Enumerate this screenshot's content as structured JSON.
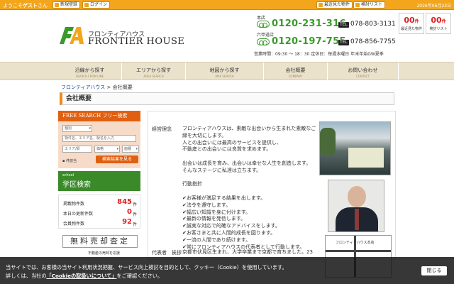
{
  "topbar": {
    "welcome_prefix": "ようこそ",
    "guest": "ゲスト",
    "welcome_suffix": "さん",
    "register": "新規登録",
    "login": "ログイン",
    "recent": "最近見た物件",
    "saved": "検討リスト",
    "date": "2026年06月23日"
  },
  "logo": {
    "jp": "フロンティアハウス",
    "en": "FRONTIER HOUSE"
  },
  "contact": {
    "main_label": "本店",
    "main_toll": "0120-231-316",
    "main_tel": "078-803-3131",
    "rokko_label": "六甲道店",
    "rokko_toll": "0120-197-755",
    "rokko_tel": "078-856-7755",
    "tel_badge": "TEL",
    "hours": "営業時間：09:30 〜 18：30 定休日：毎週水曜日 年末年始GW夏季"
  },
  "counters": [
    {
      "num": "00",
      "unit": "件",
      "label": "最近見た物件"
    },
    {
      "num": "00",
      "unit": "件",
      "label": "検討リスト"
    }
  ],
  "nav": [
    {
      "label": "沿線から探す",
      "sub": "SEARCH FROM LINE"
    },
    {
      "label": "エリアから探す",
      "sub": "AREA SEARCH"
    },
    {
      "label": "地図から探す",
      "sub": "MAP SEARCH"
    },
    {
      "label": "会社概要",
      "sub": "COMPANY"
    },
    {
      "label": "お問い合わせ",
      "sub": "CONTACT"
    }
  ],
  "breadcrumb": {
    "home": "フロンティアハウス",
    "sep": ">",
    "current": "会社概要"
  },
  "page_title": "会社概要",
  "sidebar": {
    "free_search": "FREE SEARCH フリー検索",
    "type_field": "種別",
    "keyword_placeholder": "物件名、エリア名、駅名を入力",
    "area_field": "エリア/駅",
    "price_field": "価格",
    "size_field": "面積",
    "note": "▪ 件該当",
    "search_btn": "検索結果を見る",
    "school_small": "school",
    "school_big": "学区検索",
    "stats": [
      {
        "label": "掲載物件数",
        "value": "845",
        "unit": "件"
      },
      {
        "label": "本日の更新件数",
        "value": "0",
        "unit": "件"
      },
      {
        "label": "会員物件数",
        "value": "92",
        "unit": "件"
      }
    ],
    "baikyaku": "無料売却査定",
    "baikyaku_sub": "不動産の売却を応援"
  },
  "content": {
    "rinen_label": "経営理念",
    "rinen_lines": [
      "フロンティアハウスは、素敵な出会いから生まれた素敵なご",
      "縁を大切にします。",
      "人との出会いには最高のサービスを提供し、",
      "不動産との出会いには良質を求めます。",
      "",
      "出会いは成長を育み、出会いは幸せな人生を創造します。",
      "そんなステージに私達は立ちます。",
      "",
      "行動指針",
      "",
      "✔お客様が満足する結果を出します。",
      "✔法令を遵守します。",
      "✔幅広い知識を身に付けます。",
      "✔最新の情報を発信します。",
      "✔誠実な対応で的確なアドバイスをします。",
      "✔お客さまと共に人間的成長を図ります。",
      "✔一流の人間であり続けます。",
      "✔常にフロンティアハウスの代表者として行動します。"
    ],
    "greeting_label": "代表者　挨拶",
    "greeting_text": "京都市伏見区生まれ、大学卒業まで京都で育ちました。23",
    "map_title": "フロンティアハウス本店"
  },
  "cookie": {
    "line1": "当サイトでは、お客様の当サイト利用状況把握、サービス向上検討を目的として、クッキー（Cookie）を使用しています。",
    "line2_pre": "詳しくは、当社の",
    "link": "「Cookieの取扱いについて」",
    "line2_post": "をご確認ください。",
    "close": "閉じる"
  },
  "colors": {
    "accent": "#f3a51c",
    "nav_bg": "#ebe2cc",
    "green": "#3a9a2a",
    "search": "#e06010"
  }
}
